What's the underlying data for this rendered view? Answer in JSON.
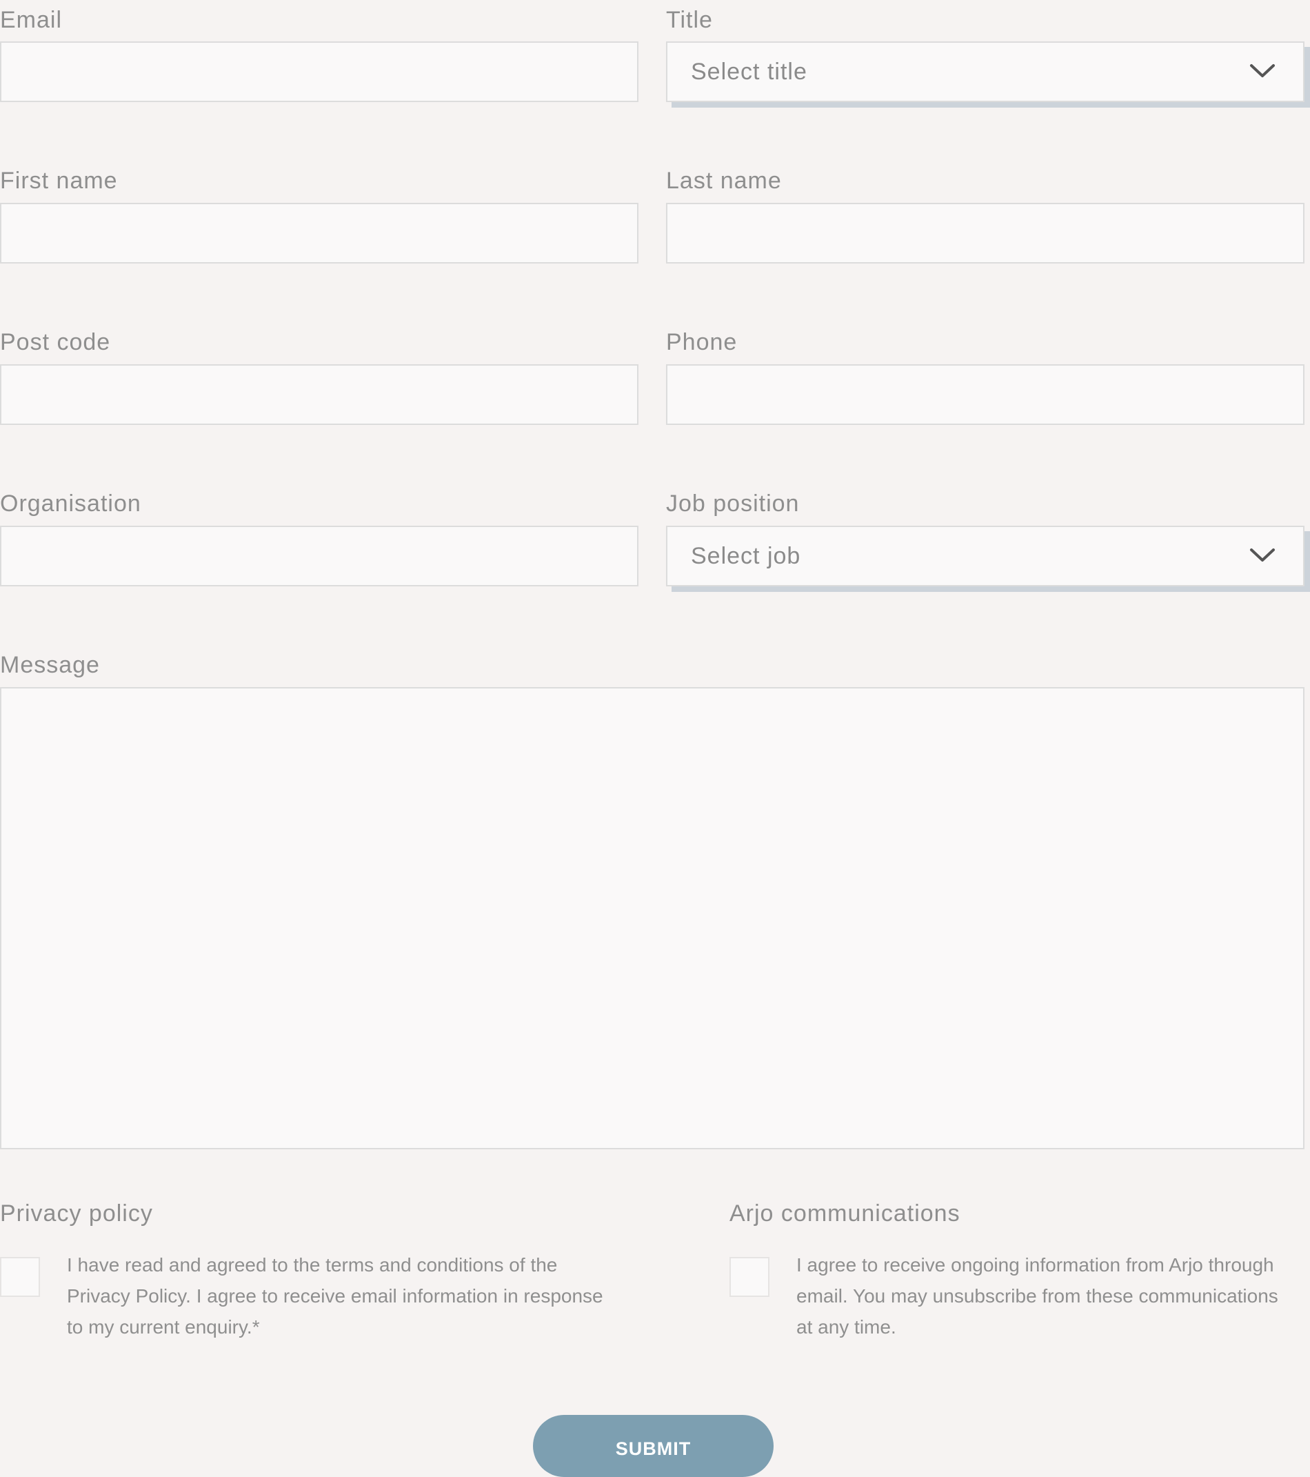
{
  "form": {
    "email": {
      "label": "Email",
      "value": ""
    },
    "title": {
      "label": "Title",
      "selected": "Select title"
    },
    "first_name": {
      "label": "First name",
      "value": ""
    },
    "last_name": {
      "label": "Last name",
      "value": ""
    },
    "post_code": {
      "label": "Post code",
      "value": ""
    },
    "phone": {
      "label": "Phone",
      "value": ""
    },
    "organisation": {
      "label": "Organisation",
      "value": ""
    },
    "job_position": {
      "label": "Job position",
      "selected": "Select job"
    },
    "message": {
      "label": "Message",
      "value": ""
    },
    "privacy": {
      "label": "Privacy policy",
      "text": "I have read and agreed to the terms and conditions of the Privacy Policy. I agree to receive email information in response to my current enquiry.*",
      "checked": false
    },
    "communications": {
      "label": "Arjo communications",
      "text": "I agree to receive ongoing information from Arjo through email. You may unsubscribe from these communications at any time.",
      "checked": false
    },
    "submit_label": "SUBMIT"
  },
  "icons": {
    "dropdown": "chevron-down-icon"
  },
  "colors": {
    "background": "#f6f3f2",
    "field_background": "#faf9f9",
    "field_border": "#dcdcdc",
    "select_shadow": "#ccd3da",
    "label_text": "#8e8e8e",
    "submit_button": "#7d9fb1",
    "submit_text": "#ffffff"
  }
}
